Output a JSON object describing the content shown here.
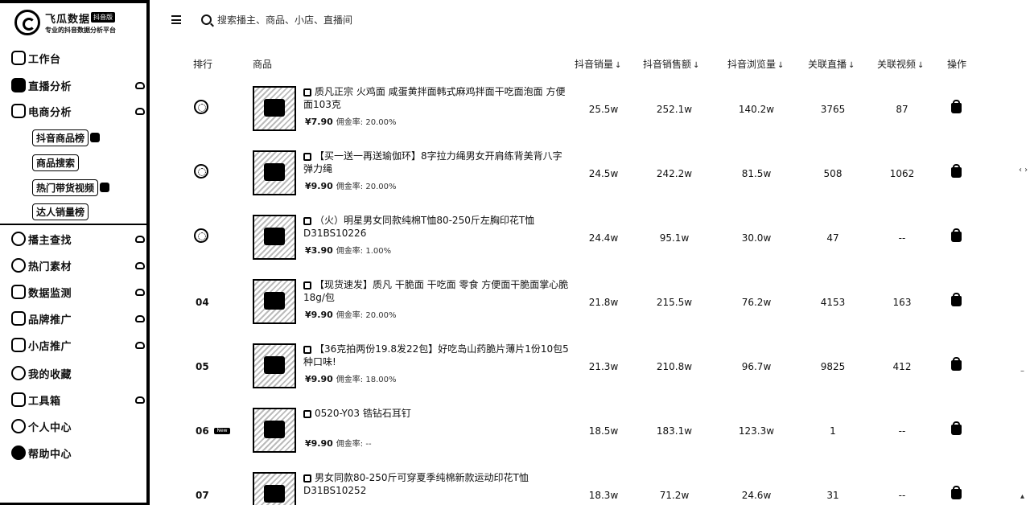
{
  "sidebar": {
    "logo_title": "飞瓜数据",
    "logo_badge": "抖音版",
    "logo_subtitle": "专业的抖音数据分析平台",
    "items": [
      {
        "label": "工作台",
        "icon": "home-icon"
      },
      {
        "label": "直播分析",
        "icon": "bar-chart-icon"
      },
      {
        "label": "电商分析",
        "icon": "shop-bag-icon"
      },
      {
        "label": "播主查找",
        "icon": "search-user-icon"
      },
      {
        "label": "热门素材",
        "icon": "flame-icon"
      },
      {
        "label": "数据监测",
        "icon": "monitor-icon"
      },
      {
        "label": "品牌推广",
        "icon": "brand-icon"
      },
      {
        "label": "小店推广",
        "icon": "store-icon"
      },
      {
        "label": "我的收藏",
        "icon": "star-icon"
      },
      {
        "label": "工具箱",
        "icon": "toolbox-icon"
      },
      {
        "label": "个人中心",
        "icon": "user-icon"
      },
      {
        "label": "帮助中心",
        "icon": "help-icon"
      }
    ],
    "sub_items": [
      {
        "label": "抖音商品榜"
      },
      {
        "label": "商品搜索"
      },
      {
        "label": "热门带货视频"
      },
      {
        "label": "达人销量榜"
      }
    ]
  },
  "search": {
    "placeholder": "搜索播主、商品、小店、直播间"
  },
  "table": {
    "headers": {
      "rank": "排行",
      "product": "商品",
      "sales": "抖音销量",
      "gmv": "抖音销售额",
      "views": "抖音浏览量",
      "live": "关联直播",
      "video": "关联视频",
      "action": "操作"
    },
    "sort_arrow": "↓",
    "rows": [
      {
        "rank": "",
        "medal": "gold",
        "new": false,
        "title": "质凡正宗 火鸡面 咸蛋黄拌面韩式麻鸡拌面干吃面泡面 方便面103克",
        "price": "¥7.90",
        "commission": "佣金率: 20.00%",
        "sales": "25.5w",
        "gmv": "252.1w",
        "views": "140.2w",
        "live": "3765",
        "video": "87"
      },
      {
        "rank": "",
        "medal": "silver",
        "new": false,
        "title": "【买一送一再送瑜伽环】8字拉力绳男女开肩练背美背八字弹力绳",
        "price": "¥9.90",
        "commission": "佣金率: 20.00%",
        "sales": "24.5w",
        "gmv": "242.2w",
        "views": "81.5w",
        "live": "508",
        "video": "1062"
      },
      {
        "rank": "",
        "medal": "bronze",
        "new": false,
        "title": "（火）明星男女同款纯棉T恤80-250斤左胸印花T恤D31BS10226",
        "price": "¥3.90",
        "commission": "佣金率: 1.00%",
        "sales": "24.4w",
        "gmv": "95.1w",
        "views": "30.0w",
        "live": "47",
        "video": "--"
      },
      {
        "rank": "04",
        "medal": "",
        "new": false,
        "title": "【现货速发】质凡 干脆面 干吃面 零食 方便面干脆面掌心脆18g/包",
        "price": "¥9.90",
        "commission": "佣金率: 20.00%",
        "sales": "21.8w",
        "gmv": "215.5w",
        "views": "76.2w",
        "live": "4153",
        "video": "163"
      },
      {
        "rank": "05",
        "medal": "",
        "new": false,
        "title": "【36克拍两份19.8发22包】好吃岛山药脆片薄片1份10包5种口味!",
        "price": "¥9.90",
        "commission": "佣金率: 18.00%",
        "sales": "21.3w",
        "gmv": "210.8w",
        "views": "96.7w",
        "live": "9825",
        "video": "412"
      },
      {
        "rank": "06",
        "medal": "",
        "new": true,
        "title": "0520-Y03 锆钻石耳钉",
        "price": "¥9.90",
        "commission": "佣金率: --",
        "sales": "18.5w",
        "gmv": "183.1w",
        "views": "123.3w",
        "live": "1",
        "video": "--"
      },
      {
        "rank": "07",
        "medal": "",
        "new": false,
        "title": "男女同款80-250斤可穿夏季纯棉新款运动印花T恤D31BS10252",
        "price": "",
        "commission": "",
        "sales": "18.3w",
        "gmv": "71.2w",
        "views": "24.6w",
        "live": "31",
        "video": "--"
      }
    ],
    "new_label": "New"
  }
}
